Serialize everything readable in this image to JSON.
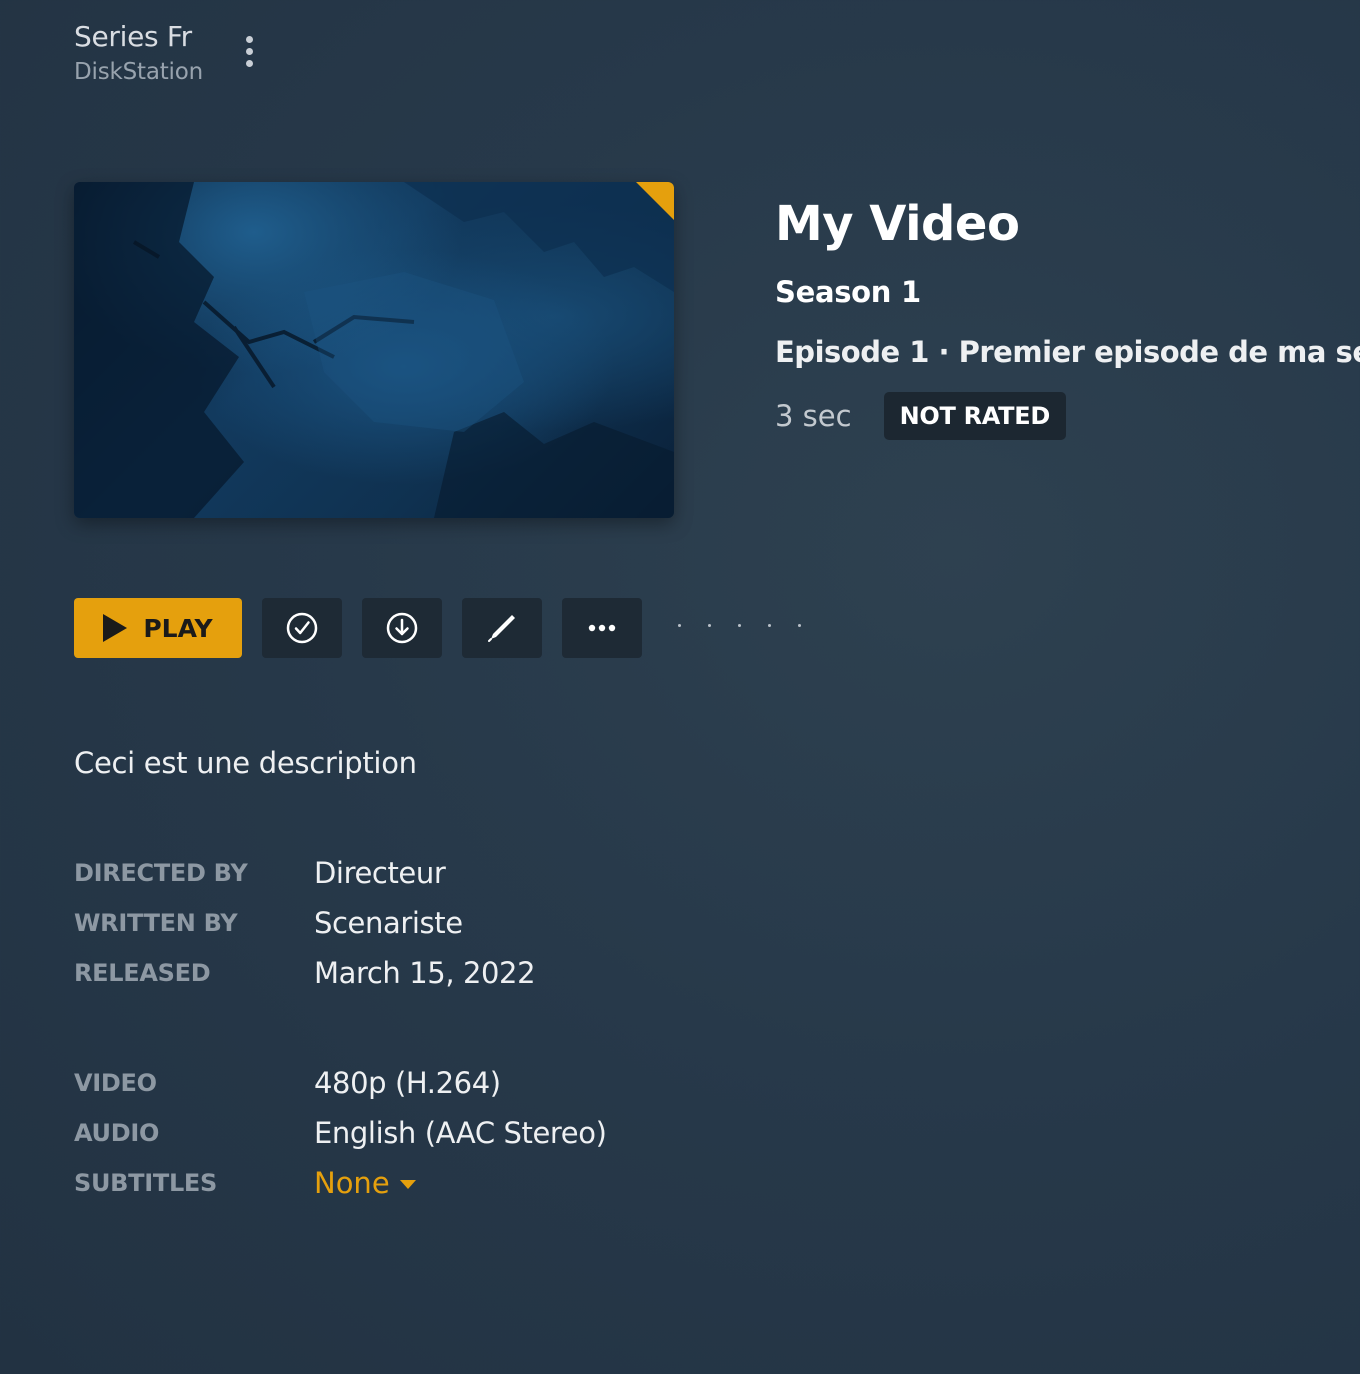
{
  "header": {
    "library_name": "Series Fr",
    "server_name": "DiskStation"
  },
  "episode": {
    "show_title": "My Video",
    "season": "Season 1",
    "episode_number": "Episode 1",
    "separator": " · ",
    "episode_title": "Premier episode de ma serie",
    "duration": "3 sec",
    "rating": "NOT RATED"
  },
  "actions": {
    "play_label": "PLAY",
    "buttons": [
      {
        "icon": "check-circle-icon"
      },
      {
        "icon": "download-icon"
      },
      {
        "icon": "pencil-icon"
      },
      {
        "icon": "ellipsis-icon"
      }
    ]
  },
  "description": "Ceci est une description",
  "credits": [
    {
      "label": "DIRECTED BY",
      "value": "Directeur"
    },
    {
      "label": "WRITTEN BY",
      "value": "Scenariste"
    },
    {
      "label": "RELEASED",
      "value": "March 15, 2022"
    }
  ],
  "media": [
    {
      "label": "VIDEO",
      "value": "480p (H.264)"
    },
    {
      "label": "AUDIO",
      "value": "English (AAC Stereo)"
    },
    {
      "label": "SUBTITLES",
      "value": "None"
    }
  ],
  "colors": {
    "accent": "#e5a00d",
    "background": "#27394a",
    "button_dark": "#1e2a35"
  }
}
